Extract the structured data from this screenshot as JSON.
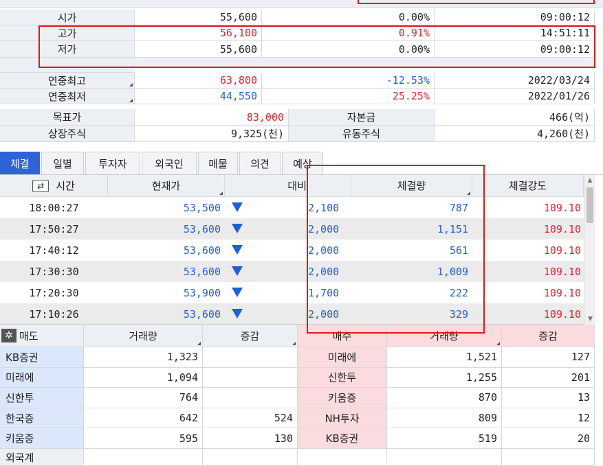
{
  "colors": {
    "up": "#e8202a",
    "down": "#1e5fd8",
    "label_bg": "#eceff3",
    "tab_active": "#2f63d8",
    "sell_bg": "#dbe7fb",
    "buy_bg": "#fadbde",
    "highlight": "#e01818"
  },
  "price_rows": [
    {
      "label": "시가",
      "price": "55,600",
      "pct": "0.00%",
      "time": "09:00:12",
      "price_color": "dark",
      "pct_color": "dark"
    },
    {
      "label": "고가",
      "price": "56,100",
      "pct": "0.91%",
      "time": "14:51:11",
      "price_color": "red",
      "pct_color": "red"
    },
    {
      "label": "저가",
      "price": "55,600",
      "pct": "0.00%",
      "time": "09:00:12",
      "price_color": "dark",
      "pct_color": "dark"
    },
    {
      "label": "연중최고",
      "price": "63,800",
      "pct": "-12.53%",
      "time": "2022/03/24",
      "price_color": "red",
      "pct_color": "blue"
    },
    {
      "label": "연중최저",
      "price": "44,550",
      "pct": "25.25%",
      "time": "2022/01/26",
      "price_color": "blue",
      "pct_color": "red"
    }
  ],
  "info_rows": [
    {
      "label1": "목표가",
      "value1": "83,000",
      "label2": "자본금",
      "value2": "466(억)"
    },
    {
      "label1": "상장주식",
      "value1": "9,325(천)",
      "label2": "유동주식",
      "value2": "4,260(천)"
    }
  ],
  "tabs": [
    "체결",
    "일별",
    "투자자",
    "외국인",
    "매물",
    "의견",
    "예상"
  ],
  "trade_headers": {
    "time": "시간",
    "price": "현재가",
    "change": "대비",
    "volume": "체결량",
    "strength": "체결강도"
  },
  "trades": [
    {
      "time": "18:00:27",
      "price": "53,500",
      "change": "2,100",
      "volume": "787",
      "strength": "109.10"
    },
    {
      "time": "17:50:27",
      "price": "53,600",
      "change": "2,000",
      "volume": "1,151",
      "strength": "109.10"
    },
    {
      "time": "17:40:12",
      "price": "53,600",
      "change": "2,000",
      "volume": "561",
      "strength": "109.10"
    },
    {
      "time": "17:30:30",
      "price": "53,600",
      "change": "2,000",
      "volume": "1,009",
      "strength": "109.10"
    },
    {
      "time": "17:20:30",
      "price": "53,900",
      "change": "1,700",
      "volume": "222",
      "strength": "109.10"
    },
    {
      "time": "17:10:26",
      "price": "53,600",
      "change": "2,000",
      "volume": "329",
      "strength": "109.10"
    }
  ],
  "broker_headers": {
    "sell": "매도",
    "sell_vol": "거래량",
    "sell_chg": "증감",
    "buy": "매수",
    "buy_vol": "거래량",
    "buy_chg": "증감"
  },
  "brokers": [
    {
      "sell": "KB증권",
      "sell_vol": "1,323",
      "sell_chg": "",
      "buy": "미래에",
      "buy_vol": "1,521",
      "buy_chg": "127"
    },
    {
      "sell": "미래에",
      "sell_vol": "1,094",
      "sell_chg": "",
      "buy": "신한투",
      "buy_vol": "1,255",
      "buy_chg": "201"
    },
    {
      "sell": "신한투",
      "sell_vol": "764",
      "sell_chg": "",
      "buy": "키움증",
      "buy_vol": "870",
      "buy_chg": "13"
    },
    {
      "sell": "한국증",
      "sell_vol": "642",
      "sell_chg": "524",
      "buy": "NH투자",
      "buy_vol": "809",
      "buy_chg": "12"
    },
    {
      "sell": "키움증",
      "sell_vol": "595",
      "sell_chg": "130",
      "buy": "KB증권",
      "buy_vol": "519",
      "buy_chg": "20"
    }
  ],
  "foreign_total_label": "외국계"
}
